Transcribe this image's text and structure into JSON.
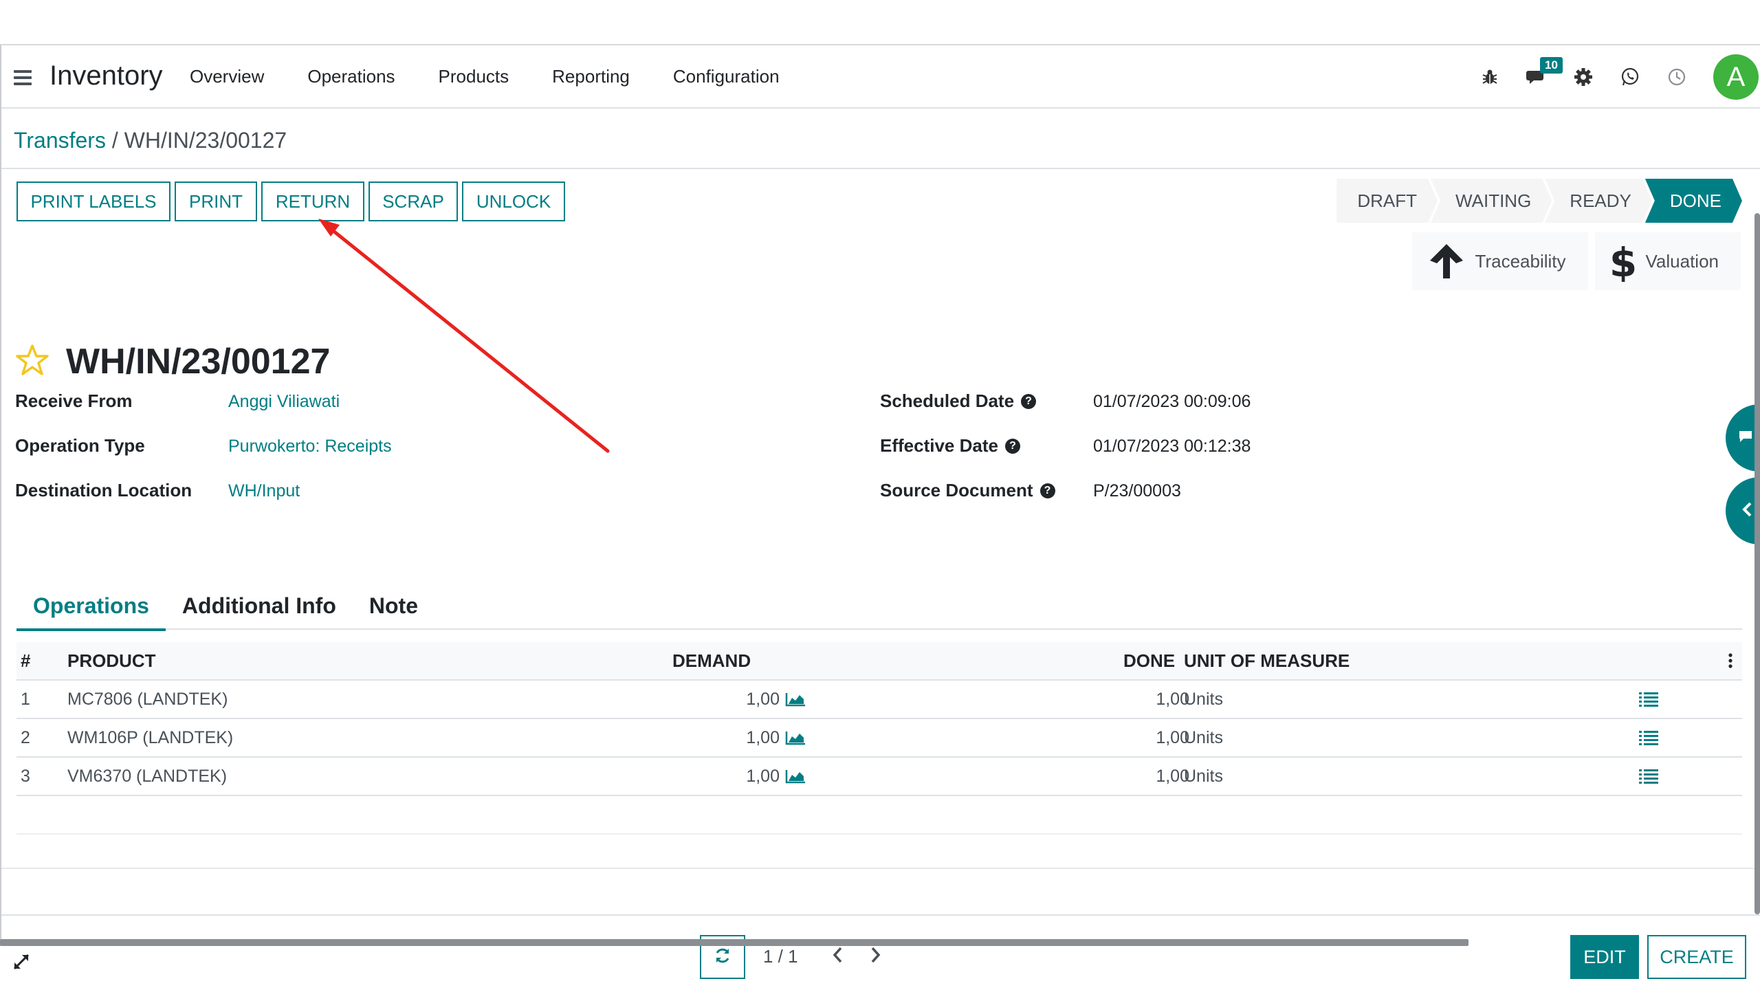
{
  "app": {
    "title": "Inventory"
  },
  "nav": {
    "items": [
      "Overview",
      "Operations",
      "Products",
      "Reporting",
      "Configuration"
    ]
  },
  "systray": {
    "message_count": "10",
    "avatar_letter": "A"
  },
  "breadcrumb": {
    "parent": "Transfers",
    "separator": "/",
    "current": "WH/IN/23/00127"
  },
  "actions": {
    "print_labels": "PRINT LABELS",
    "print": "PRINT",
    "return": "RETURN",
    "scrap": "SCRAP",
    "unlock": "UNLOCK"
  },
  "status": {
    "stages": [
      "DRAFT",
      "WAITING",
      "READY",
      "DONE"
    ],
    "active": "DONE"
  },
  "smart_buttons": {
    "traceability": "Traceability",
    "valuation": "Valuation"
  },
  "record": {
    "name": "WH/IN/23/00127"
  },
  "fields": {
    "receive_from": {
      "label": "Receive From",
      "value": "Anggi Viliawati"
    },
    "operation_type": {
      "label": "Operation Type",
      "value": "Purwokerto: Receipts"
    },
    "destination_location": {
      "label": "Destination Location",
      "value": "WH/Input"
    },
    "scheduled_date": {
      "label": "Scheduled Date",
      "value": "01/07/2023 00:09:06"
    },
    "effective_date": {
      "label": "Effective Date",
      "value": "01/07/2023 00:12:38"
    },
    "source_document": {
      "label": "Source Document",
      "value": "P/23/00003"
    }
  },
  "tabs": {
    "operations": "Operations",
    "additional_info": "Additional Info",
    "note": "Note",
    "active": "Operations"
  },
  "table": {
    "headers": {
      "num": "#",
      "product": "PRODUCT",
      "demand": "DEMAND",
      "done": "DONE",
      "uom": "UNIT OF MEASURE"
    },
    "rows": [
      {
        "num": "1",
        "product": "MC7806 (LANDTEK)",
        "demand": "1,00",
        "done": "1,00",
        "uom": "Units"
      },
      {
        "num": "2",
        "product": "WM106P (LANDTEK)",
        "demand": "1,00",
        "done": "1,00",
        "uom": "Units"
      },
      {
        "num": "3",
        "product": "VM6370 (LANDTEK)",
        "demand": "1,00",
        "done": "1,00",
        "uom": "Units"
      }
    ]
  },
  "pager": {
    "value": "1 / 1"
  },
  "bottom_actions": {
    "edit": "EDIT",
    "create": "CREATE"
  },
  "colors": {
    "accent": "#017e84",
    "avatar": "#3eb33e",
    "annotation_arrow": "#e8231f",
    "favorite_star": "#f3c623"
  },
  "icons": [
    "menu-icon",
    "bug-icon",
    "chat-icon",
    "gear-icon",
    "whatsapp-icon",
    "clock-icon",
    "star-icon",
    "arrow-up-icon",
    "dollar-icon",
    "help-icon",
    "area-chart-icon",
    "list-icon",
    "kebab-icon",
    "refresh-icon",
    "chevron-left-icon",
    "chevron-right-icon",
    "expand-icon",
    "chat-bubble-icon"
  ]
}
